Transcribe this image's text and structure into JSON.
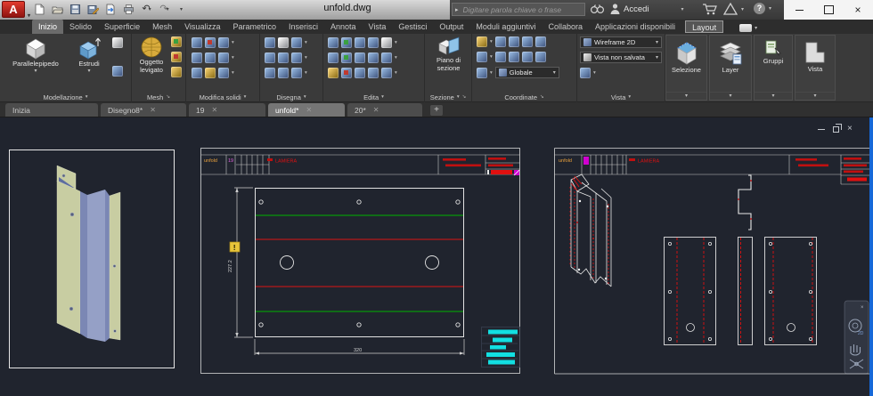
{
  "titlebar": {
    "logo": "A",
    "title": "unfold.dwg",
    "search": {
      "placeholder": "Digitare parola chiave o frase"
    },
    "signin": "Accedi",
    "icons": [
      "app-menu",
      "new-drawing",
      "open",
      "save",
      "save-as",
      "transfer",
      "plot",
      "undo",
      "redo",
      "qat-customize",
      "search-go",
      "binoculars",
      "user",
      "cart",
      "autodesk-app",
      "help",
      "minimize",
      "maximize",
      "close"
    ]
  },
  "ribbon": {
    "tabs": [
      "Inizio",
      "Solido",
      "Superficie",
      "Mesh",
      "Visualizza",
      "Parametrico",
      "Inserisci",
      "Annota",
      "Vista",
      "Gestisci",
      "Output",
      "Moduli aggiuntivi",
      "Collabora",
      "Applicazioni disponibili",
      "Layout"
    ],
    "panels": {
      "modellazione": {
        "caption": "Modellazione",
        "parallelepipedo": "Parallelepipedo",
        "estrudi": "Estrudi"
      },
      "mesh": {
        "caption": "Mesh",
        "oggetto_levigato": "Oggetto levigato"
      },
      "modifica_solidi": {
        "caption": "Modifica solidi"
      },
      "disegna": {
        "caption": "Disegna"
      },
      "edita": {
        "caption": "Edita"
      },
      "sezione": {
        "caption": "Sezione",
        "piano_di_sezione": "Piano di sezione"
      },
      "coordinate": {
        "caption": "Coordinate",
        "ucs_value": "Globale"
      },
      "vista": {
        "caption": "Vista",
        "visual_style": "Wireframe 2D",
        "view_value": "Vista non salvata"
      },
      "selezione": {
        "label": "Selezione"
      },
      "layer": {
        "label": "Layer"
      },
      "gruppi": {
        "label": "Gruppi"
      },
      "vista_tile": {
        "label": "Vista"
      }
    }
  },
  "file_tabs": {
    "items": [
      "Inizia",
      "Disegno8*",
      "19",
      "unfold*",
      "20*"
    ],
    "new_tab": "+"
  },
  "canvas": {
    "middle_sheet": {
      "name": "unfold",
      "sheet_no": "19",
      "title": "LAMIERA",
      "dim_height": "227.2",
      "dim_width": "320",
      "warning": "!"
    },
    "right_sheet": {
      "name": "unfold",
      "title": "LAMIERA"
    },
    "nav_2d": "2D",
    "icons": [
      "drawing-minimize",
      "drawing-restore",
      "drawing-close",
      "navbar-close",
      "zoom-wheel-2d",
      "pan-hand",
      "orbit"
    ]
  },
  "colors": {
    "accent_blue": "#1668d8",
    "entity_red": "#e01010",
    "bend_green": "#00b400",
    "cyan": "#12dfe2",
    "warning_yellow": "#e8c53a",
    "sheet_orange": "#e8a03c",
    "magenta": "#d000d0"
  }
}
